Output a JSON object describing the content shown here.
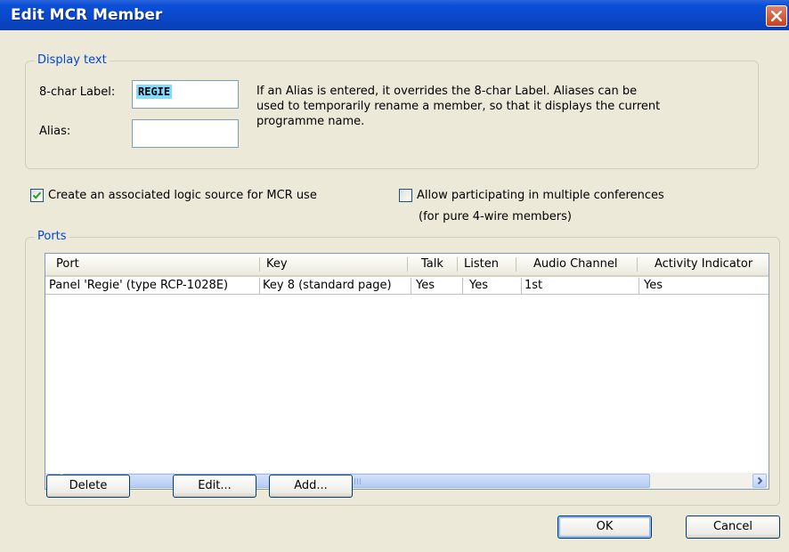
{
  "window": {
    "title": "Edit MCR Member"
  },
  "display_text": {
    "legend": "Display text",
    "label_caption": "8-char Label:",
    "label_value": "REGIE",
    "alias_caption": "Alias:",
    "alias_value": "",
    "help_text": "If an Alias is entered, it overrides the 8-char Label. Aliases can be used to temporarily rename a member, so that it displays the current programme name."
  },
  "options": {
    "logic_source_label": "Create an associated logic source for MCR use",
    "logic_source_checked": true,
    "multi_conf_label": "Allow participating in multiple conferences",
    "multi_conf_note": "(for pure 4-wire members)",
    "multi_conf_checked": false
  },
  "ports": {
    "legend": "Ports",
    "columns": [
      "Port",
      "Key",
      "Talk",
      "Listen",
      "Audio Channel",
      "Activity Indicator"
    ],
    "rows": [
      [
        "Panel 'Regie' (type RCP-1028E)",
        "Key 8 (standard page)",
        "Yes",
        "Yes",
        "1st",
        "Yes"
      ]
    ],
    "delete_label": "Delete",
    "edit_label": "Edit...",
    "add_label": "Add..."
  },
  "buttons": {
    "ok_label": "OK",
    "cancel_label": "Cancel"
  },
  "icons": {
    "close": "close-icon",
    "check": "checkmark-icon",
    "scroll_left": "chevron-left-icon",
    "scroll_right": "chevron-right-icon"
  },
  "colors": {
    "title_bar": "#0a4fd6",
    "group_legend": "#0046d5",
    "label_highlight": "#7fdbff"
  }
}
